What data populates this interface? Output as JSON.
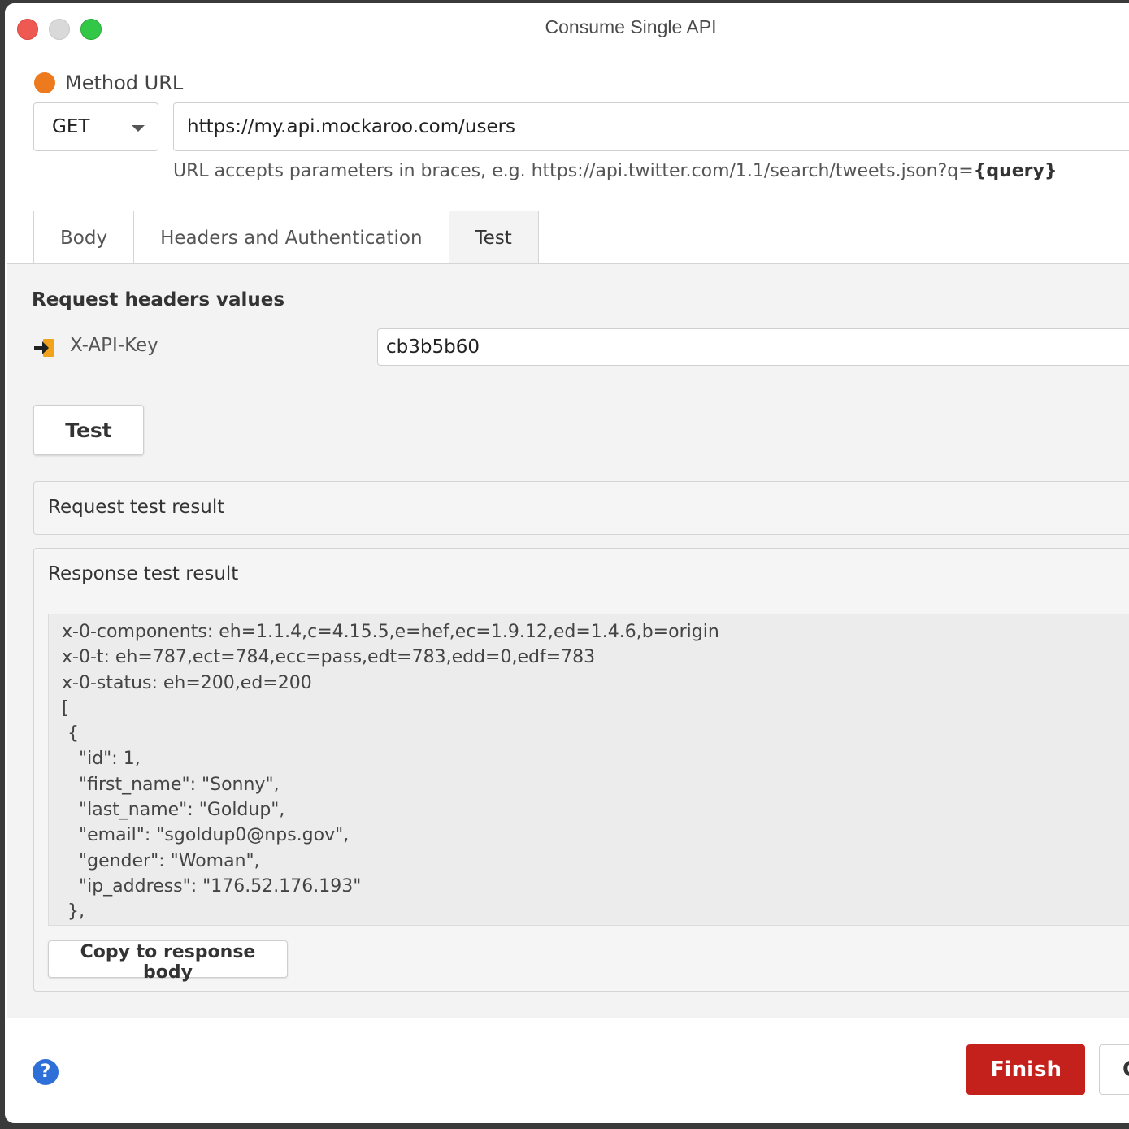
{
  "window": {
    "title": "Consume Single API"
  },
  "method_url": {
    "label": "Method URL",
    "method": "GET",
    "url": "https://my.api.mockaroo.com/users",
    "hint_prefix": "URL accepts parameters in braces, e.g. https://api.twitter.com/1.1/search/tweets.json?q=",
    "hint_param": "{query}"
  },
  "tabs": [
    {
      "label": "Body"
    },
    {
      "label": "Headers and Authentication"
    },
    {
      "label": "Test",
      "active": true
    }
  ],
  "test_panel": {
    "section_title": "Request headers values",
    "header_key": "X-API-Key",
    "header_value": "cb3b5b60",
    "test_button": "Test",
    "request_result_label": "Request test result",
    "response_result_label": "Response test result",
    "response_lines": [
      "x-0-components: eh=1.1.4,c=4.15.5,e=hef,ec=1.9.12,ed=1.4.6,b=origin",
      "x-0-t: eh=787,ect=784,ecc=pass,edt=783,edd=0,edf=783",
      "x-0-status: eh=200,ed=200",
      "[",
      " {",
      "   \"id\": 1,",
      "   \"first_name\": \"Sonny\",",
      "   \"last_name\": \"Goldup\",",
      "   \"email\": \"sgoldup0@nps.gov\",",
      "   \"gender\": \"Woman\",",
      "   \"ip_address\": \"176.52.176.193\"",
      " },"
    ],
    "copy_button": "Copy to response body"
  },
  "footer": {
    "help": "?",
    "finish_button": "Finish",
    "cancel_button": "Cancel"
  },
  "colors": {
    "status_dot": "#ee7a1e",
    "finish_bg": "#c4201c",
    "help_bg": "#2f6fd8"
  },
  "icons": {
    "header_icon": "enter-arrow-icon",
    "help_icon": "help-icon"
  }
}
